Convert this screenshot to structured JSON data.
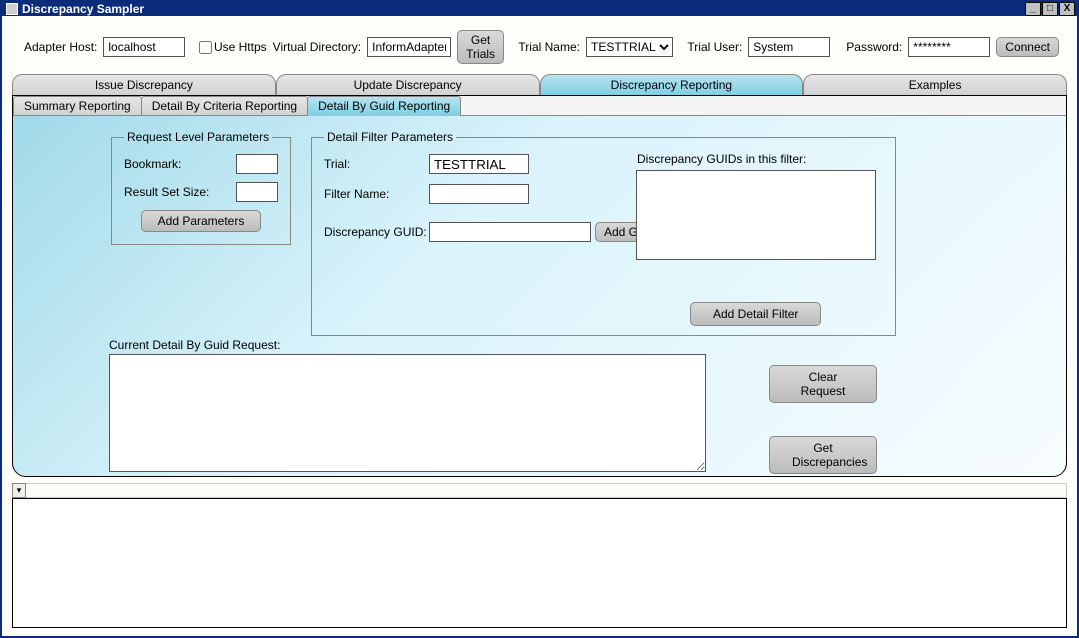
{
  "window": {
    "title": "Discrepancy Sampler"
  },
  "toolbar": {
    "adapter_host_label": "Adapter Host:",
    "adapter_host_value": "localhost",
    "use_https_label": "Use Https",
    "virtual_dir_label": "Virtual Directory:",
    "virtual_dir_value": "InformAdapter",
    "get_trials_label": "Get Trials",
    "trial_name_label": "Trial Name:",
    "trial_name_value": "TESTTRIAL",
    "trial_user_label": "Trial User:",
    "trial_user_value": "System",
    "password_label": "Password:",
    "password_value": "********",
    "connect_label": "Connect"
  },
  "tabs": {
    "main": {
      "issue": "Issue Discrepancy",
      "update": "Update Discrepancy",
      "reporting": "Discrepancy Reporting",
      "examples": "Examples"
    },
    "sub": {
      "summary": "Summary Reporting",
      "criteria": "Detail By Criteria Reporting",
      "guid": "Detail By Guid Reporting"
    }
  },
  "request_level": {
    "legend": "Request Level Parameters",
    "bookmark_label": "Bookmark:",
    "bookmark_value": "",
    "result_size_label": "Result Set Size:",
    "result_size_value": "",
    "add_params_label": "Add Parameters"
  },
  "detail_filter": {
    "legend": "Detail Filter Parameters",
    "trial_label": "Trial:",
    "trial_value": "TESTTRIAL",
    "filter_name_label": "Filter Name:",
    "filter_name_value": "",
    "disc_guid_label": "Discrepancy GUID:",
    "disc_guid_value": "",
    "add_guid_label": "Add Guid",
    "guid_list_label": "Discrepancy GUIDs in this filter:",
    "add_detail_filter_label": "Add Detail Filter"
  },
  "request_box": {
    "label": "Current Detail By Guid Request:",
    "value": ""
  },
  "buttons": {
    "clear_request": "Clear Request",
    "get_discrepancies": "Get Discrepancies"
  },
  "collapse_glyph": "▾"
}
